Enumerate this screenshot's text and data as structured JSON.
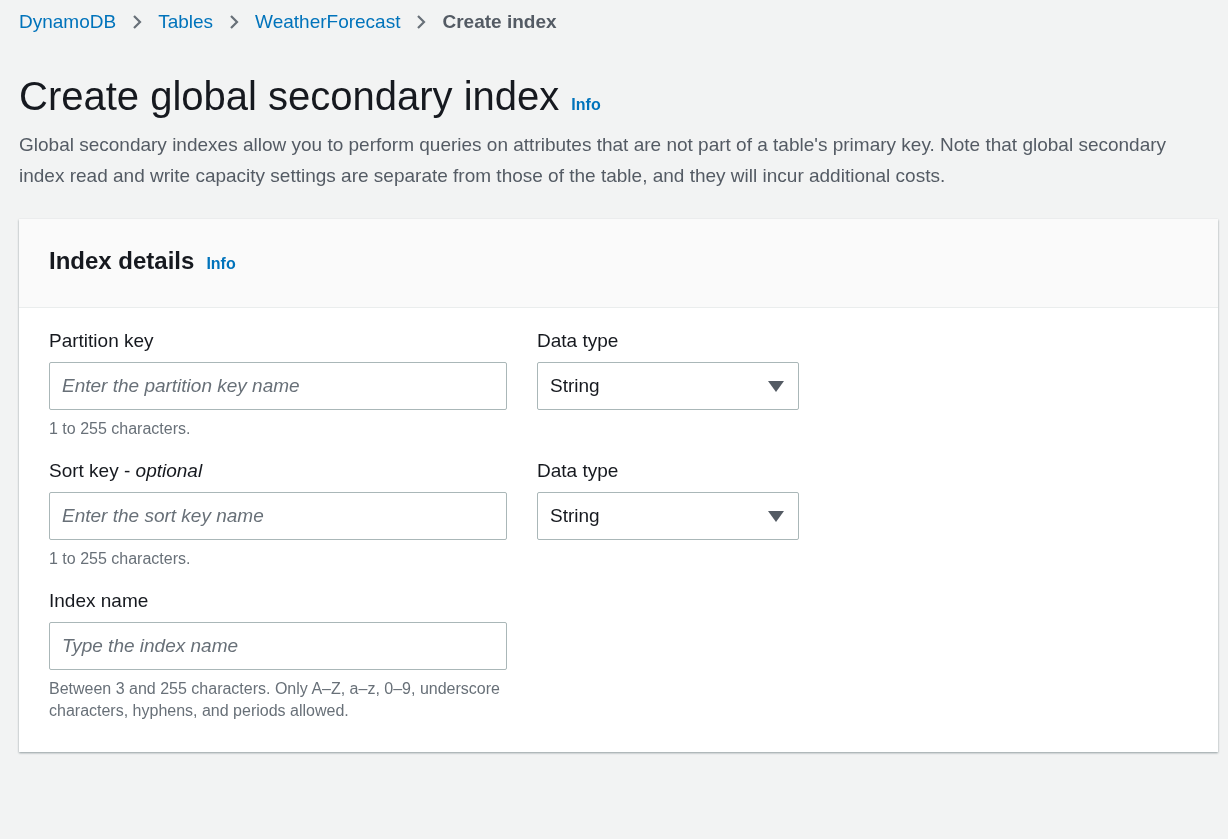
{
  "breadcrumbs": [
    {
      "label": "DynamoDB",
      "current": false
    },
    {
      "label": "Tables",
      "current": false
    },
    {
      "label": "WeatherForecast",
      "current": false
    },
    {
      "label": "Create index",
      "current": true
    }
  ],
  "page": {
    "title": "Create global secondary index",
    "info": "Info",
    "description": "Global secondary indexes allow you to perform queries on attributes that are not part of a table's primary key. Note that global secondary index read and write capacity settings are separate from those of the table, and they will incur additional costs."
  },
  "panel": {
    "title": "Index details",
    "info": "Info",
    "fields": [
      {
        "label": "Partition key",
        "placeholder": "Enter the partition key name",
        "hint": "1 to 255 characters.",
        "data_type": {
          "label": "Data type",
          "value": "String"
        }
      },
      {
        "label": "Sort key - *optional*",
        "placeholder": "Enter the sort key name",
        "hint": "1 to 255 characters.",
        "data_type": {
          "label": "Data type",
          "value": "String"
        }
      },
      {
        "label": "Index name",
        "placeholder": "Type the index name",
        "hint": "Between 3 and 255 characters. Only A–Z, a–z, 0–9, underscore characters, hyphens, and periods allowed."
      }
    ]
  }
}
